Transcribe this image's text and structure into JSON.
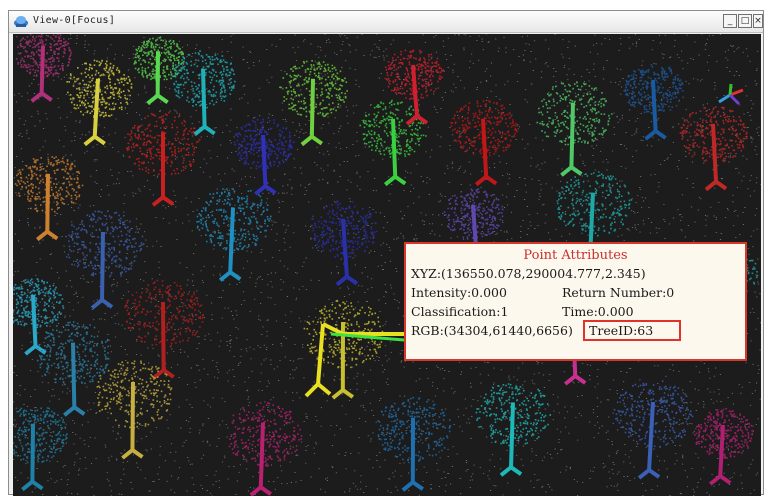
{
  "window": {
    "title": "View-0[Focus]",
    "buttons": {
      "minimize": "_",
      "maximize": "□",
      "close": "×"
    }
  },
  "icons": {
    "app": "app-view-icon",
    "axis": "axis-gizmo-icon"
  },
  "tooltip": {
    "title": "Point Attributes",
    "xyz": "XYZ:(136550.078,290004.777,2.345)",
    "intensity": "Intensity:0.000",
    "return_number": "Return Number:0",
    "classification": "Classification:1",
    "time": "Time:0.000",
    "rgb": "RGB:(34304,61440,6656)",
    "tree_id": "TreeID:63"
  },
  "colors": {
    "highlight_box": "#e0322a",
    "tooltip_bg": "#fdf8ee",
    "tooltip_title": "#c9302c"
  }
}
